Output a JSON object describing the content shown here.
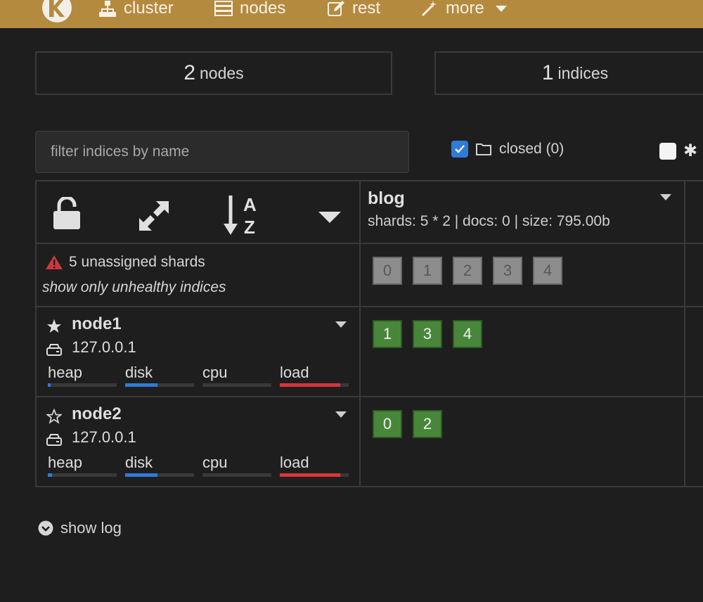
{
  "nav": {
    "cluster": "cluster",
    "nodes": "nodes",
    "rest": "rest",
    "more": "more"
  },
  "summary": {
    "nodes_count": "2",
    "nodes_label": "nodes",
    "indices_count": "1",
    "indices_label": "indices"
  },
  "filter": {
    "placeholder": "filter indices by name",
    "closed_label": "closed (0)",
    "closed_checked": true,
    "special_checked": false,
    "special_label": "✱"
  },
  "index": {
    "name": "blog",
    "stats": "shards: 5 * 2 | docs: 0 | size: 795.00b"
  },
  "warnings": {
    "unassigned": "5 unassigned shards",
    "unhealthy_link": "show only unhealthy indices"
  },
  "unassigned_shards": [
    "0",
    "1",
    "2",
    "3",
    "4"
  ],
  "nodes": [
    {
      "name": "node1",
      "master": true,
      "ip": "127.0.0.1",
      "shards": [
        "1",
        "3",
        "4"
      ],
      "metrics": [
        {
          "label": "heap",
          "level": 0.04,
          "color": "#2f7bd8"
        },
        {
          "label": "disk",
          "level": 0.47,
          "color": "#2f7bd8"
        },
        {
          "label": "cpu",
          "level": 0.0,
          "color": "#2f7bd8"
        },
        {
          "label": "load",
          "level": 0.88,
          "color": "#d9353a"
        }
      ]
    },
    {
      "name": "node2",
      "master": false,
      "ip": "127.0.0.1",
      "shards": [
        "0",
        "2"
      ],
      "metrics": [
        {
          "label": "heap",
          "level": 0.06,
          "color": "#2f7bd8"
        },
        {
          "label": "disk",
          "level": 0.47,
          "color": "#2f7bd8"
        },
        {
          "label": "cpu",
          "level": 0.0,
          "color": "#2f7bd8"
        },
        {
          "label": "load",
          "level": 0.88,
          "color": "#d9353a"
        }
      ]
    }
  ],
  "show_log": "show log"
}
